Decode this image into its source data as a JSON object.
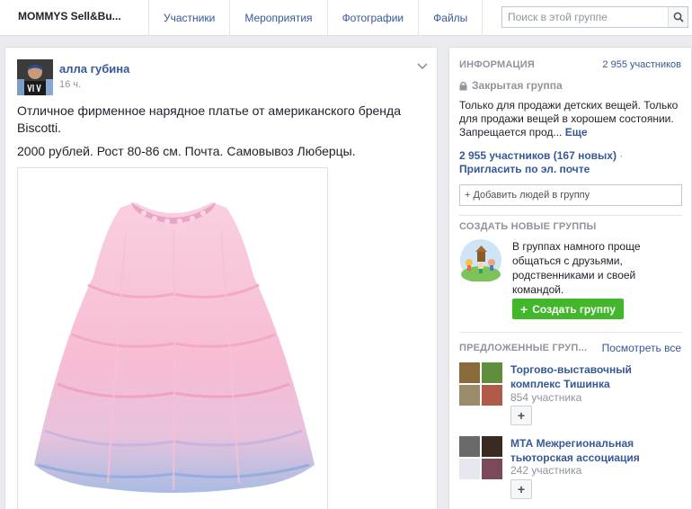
{
  "topbar": {
    "group_title": "MOMMYS Sell&Bu...",
    "tabs": [
      "Участники",
      "Мероприятия",
      "Фотографии",
      "Файлы"
    ],
    "search_placeholder": "Поиск в этой группе"
  },
  "post": {
    "author": "алла губина",
    "time": "16 ч.",
    "text_1": "Отличное фирменное нарядное платье от американского бренда Biscotti.",
    "text_2": "2000 рублей. Рост 80-86 см. Почта. Самовывоз Люберцы."
  },
  "sidebar": {
    "info": {
      "header": "ИНФОРМАЦИЯ",
      "members_link": "2 955 участников",
      "privacy": "Закрытая группа",
      "description": "Только для продажи детских вещей. Только для продажи вещей в хорошем состоянии. Запрещается прод...",
      "more_link": "Еще",
      "members_stat": "2 955 участников (167 новых)",
      "invite_link": "Пригласить по эл. почте",
      "add_people_placeholder": "+ Добавить людей в группу"
    },
    "create": {
      "header": "СОЗДАТЬ НОВЫЕ ГРУППЫ",
      "text": "В группах намного проще общаться с друзьями, родственниками и своей командой.",
      "button": "Создать группу"
    },
    "suggested": {
      "header": "ПРЕДЛОЖЕННЫЕ ГРУП...",
      "see_all": "Посмотреть все",
      "groups": [
        {
          "name": "Торгово-выставочный комплекс Тишинка",
          "members": "854 участника"
        },
        {
          "name": "МТА Межрегиональная тьюторская ассоциация",
          "members": "242 участника"
        }
      ]
    }
  },
  "colors": {
    "link": "#365899",
    "accent_green": "#42b72a",
    "background": "#e9ebee"
  }
}
